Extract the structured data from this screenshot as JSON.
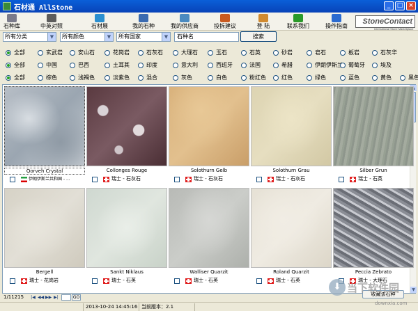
{
  "window": {
    "title": "石材通 AllStone"
  },
  "toolbar": [
    {
      "label": "石种库",
      "icon": "stone-library-icon",
      "color": "#7a7a8a"
    },
    {
      "label": "中英对照",
      "icon": "translate-icon",
      "color": "#5c5c5c"
    },
    {
      "label": "石材展",
      "icon": "globe-icon",
      "color": "#2a8fd0"
    },
    {
      "label": "我的石种",
      "icon": "user-stone-icon",
      "color": "#3a6ab0"
    },
    {
      "label": "我的供应商",
      "icon": "supplier-icon",
      "color": "#4a8ac0"
    },
    {
      "label": "投拆建议",
      "icon": "feedback-icon",
      "color": "#c85a20"
    },
    {
      "label": "登 陆",
      "icon": "login-icon",
      "color": "#d08a30"
    },
    {
      "label": "联系我们",
      "icon": "phone-icon",
      "color": "#2a9a2a"
    },
    {
      "label": "操作指南",
      "icon": "help-icon",
      "color": "#2a6ad0"
    }
  ],
  "logo": {
    "text": "StoneContact",
    "sub": "International Stone Marketplace"
  },
  "filters": {
    "category": "所有分类",
    "color": "所有颜色",
    "country": "所有国家",
    "name_value": "石种名",
    "search_label": "搜索"
  },
  "radio_rows": {
    "category": [
      {
        "label": "全部",
        "checked": true
      },
      {
        "label": "玄武岩",
        "checked": false
      },
      {
        "label": "安山石",
        "checked": false
      },
      {
        "label": "花岗岩",
        "checked": false
      },
      {
        "label": "石灰石",
        "checked": false
      },
      {
        "label": "大理石",
        "checked": false
      },
      {
        "label": "玉石",
        "checked": false
      },
      {
        "label": "石英",
        "checked": false
      },
      {
        "label": "砂岩",
        "checked": false
      },
      {
        "label": "皂石",
        "checked": false
      },
      {
        "label": "板岩",
        "checked": false
      },
      {
        "label": "石灰华",
        "checked": false
      }
    ],
    "country": [
      {
        "label": "全部",
        "checked": true
      },
      {
        "label": "中国",
        "checked": false
      },
      {
        "label": "巴西",
        "checked": false
      },
      {
        "label": "土耳其",
        "checked": false
      },
      {
        "label": "印度",
        "checked": false
      },
      {
        "label": "意大利",
        "checked": false
      },
      {
        "label": "西班牙",
        "checked": false
      },
      {
        "label": "法国",
        "checked": false
      },
      {
        "label": "希腊",
        "checked": false
      },
      {
        "label": "伊朗伊斯兰",
        "checked": false
      },
      {
        "label": "葡萄牙",
        "checked": false
      },
      {
        "label": "埃及",
        "checked": false
      }
    ],
    "color": [
      {
        "label": "全部",
        "checked": true
      },
      {
        "label": "棕色",
        "checked": false
      },
      {
        "label": "浅褐色",
        "checked": false
      },
      {
        "label": "淡紫色",
        "checked": false
      },
      {
        "label": "混合",
        "checked": false
      },
      {
        "label": "灰色",
        "checked": false
      },
      {
        "label": "白色",
        "checked": false
      },
      {
        "label": "粉红色",
        "checked": false
      },
      {
        "label": "红色",
        "checked": false
      },
      {
        "label": "绿色",
        "checked": false
      },
      {
        "label": "蓝色",
        "checked": false
      },
      {
        "label": "黄色",
        "checked": false
      },
      {
        "label": "黑色",
        "checked": false
      }
    ]
  },
  "stones": [
    {
      "name": "Qorveh Crystal",
      "origin": "伊朗伊斯兰共和国 - ...",
      "flag": "iran",
      "tone": "qorveh",
      "selected": true
    },
    {
      "name": "Collonges Rouge",
      "origin": "瑞士 - 石灰石",
      "flag": "swiss",
      "tone": "collonges",
      "selected": false
    },
    {
      "name": "Solothurn Gelb",
      "origin": "瑞士 - 石灰石",
      "flag": "swiss",
      "tone": "gelb",
      "selected": false
    },
    {
      "name": "Solothurn Grau",
      "origin": "瑞士 - 石灰石",
      "flag": "swiss",
      "tone": "grau",
      "selected": false
    },
    {
      "name": "Silber Grun",
      "origin": "瑞士 - 石英",
      "flag": "swiss",
      "tone": "silber",
      "selected": false
    },
    {
      "name": "Bergell",
      "origin": "瑞士 - 花岗岩",
      "flag": "swiss",
      "tone": "bergell",
      "selected": false
    },
    {
      "name": "Sankt Niklaus",
      "origin": "瑞士 - 石英",
      "flag": "swiss",
      "tone": "niklaus",
      "selected": false
    },
    {
      "name": "Walliser Quarzit",
      "origin": "瑞士 - 石英",
      "flag": "swiss",
      "tone": "walliser",
      "selected": false
    },
    {
      "name": "Roland Quarzit",
      "origin": "瑞士 - 石英",
      "flag": "swiss",
      "tone": "roland",
      "selected": false
    },
    {
      "name": "Peccia Zebrato",
      "origin": "瑞士 - 大理石",
      "flag": "swiss",
      "tone": "peccia",
      "selected": false
    }
  ],
  "pager": {
    "text": "1/11215",
    "go_label": "GO"
  },
  "favorite_label": "收藏该石种",
  "status": {
    "datetime": "2013-10-24 14:45:16",
    "version": "当前版本：2.1"
  },
  "watermark": {
    "text": "当下软件园",
    "sub": "downxia.com"
  },
  "colors": {
    "titlebar": "#0a5fd8",
    "radio_selected": "#21a121",
    "swiss_red": "#e02020"
  }
}
